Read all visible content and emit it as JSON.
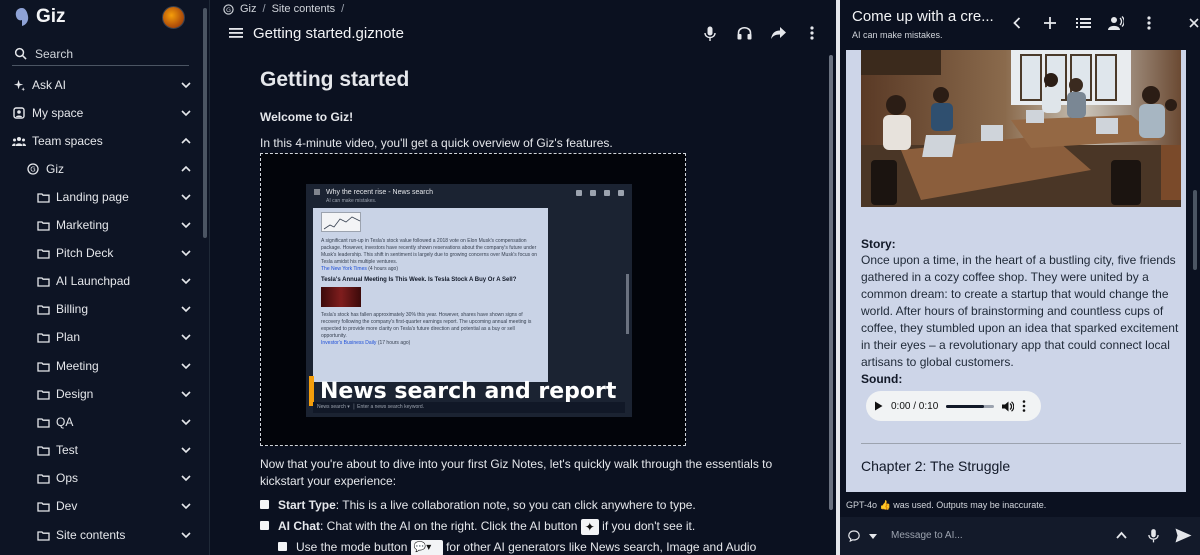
{
  "sidebar": {
    "brand": "Giz",
    "search_label": "Search",
    "items": [
      {
        "label": "Ask AI",
        "icon": "sparkle-icon"
      },
      {
        "label": "My space",
        "icon": "person-square-icon"
      },
      {
        "label": "Team spaces",
        "icon": "team-icon"
      },
      {
        "label": "Giz",
        "icon": "giz-icon"
      },
      {
        "label": "Landing page",
        "icon": "folder-icon"
      },
      {
        "label": "Marketing",
        "icon": "folder-icon"
      },
      {
        "label": "Pitch Deck",
        "icon": "folder-icon"
      },
      {
        "label": "AI Launchpad",
        "icon": "folder-icon"
      },
      {
        "label": "Billing",
        "icon": "folder-icon"
      },
      {
        "label": "Plan",
        "icon": "folder-icon"
      },
      {
        "label": "Meeting",
        "icon": "folder-icon"
      },
      {
        "label": "Design",
        "icon": "folder-icon"
      },
      {
        "label": "QA",
        "icon": "folder-icon"
      },
      {
        "label": "Test",
        "icon": "folder-icon"
      },
      {
        "label": "Ops",
        "icon": "folder-icon"
      },
      {
        "label": "Dev",
        "icon": "folder-icon"
      },
      {
        "label": "Site contents",
        "icon": "folder-icon"
      }
    ]
  },
  "main": {
    "breadcrumb": [
      "Giz",
      "Site contents"
    ],
    "breadcrumb_sep": "/",
    "doc_title": "Getting started.giznote",
    "heading": "Getting started",
    "welcome": "Welcome to Giz!",
    "intro": "In this 4-minute video, you'll get a quick overview of Giz's features.",
    "video": {
      "title": "Why the recent rise - News search",
      "subtitle": "AI can make mistakes.",
      "p1": "A significant run-up in Tesla's stock value followed a 2018 vote on Elon Musk's compensation package. However, investors have recently shown reservations about the company's future under Musk's leadership. This shift in sentiment is largely due to growing concerns over Musk's focus on Tesla amidst his multiple ventures.",
      "source1": "The New York Times",
      "source1_time": "(4 hours ago)",
      "headline": "Tesla's Annual Meeting Is This Week. Is Tesla Stock A Buy Or A Sell?",
      "p2": "Tesla's stock has fallen approximately 30% this year. However, shares have shown signs of recovery following the company's first-quarter earnings report. The upcoming annual meeting is expected to provide more clarity on Tesla's future direction and potential as a buy or sell opportunity.",
      "source2": "Investor's Business Daily",
      "source2_time": "(17 hours ago)",
      "caption": "News search and report",
      "mode": "News search",
      "input_placeholder": "Enter a news search keyword."
    },
    "para": "Now that you're about to dive into your first Giz Notes, let's quickly walk through the essentials to kickstart your experience:",
    "checks": [
      {
        "bold": "Start Type",
        "text": ": This is a live collaboration note, so you can click anywhere to type."
      },
      {
        "bold": "AI Chat",
        "text": ": Chat with the AI on the right. Click the AI button",
        "tail": "if you don't see it."
      },
      {
        "bold": "",
        "text": "Use the mode button",
        "tail": "for other AI generators like News search, Image and Audio"
      }
    ]
  },
  "chat": {
    "title": "Come up with a cre...",
    "subtitle": "AI can make mistakes.",
    "story_label": "Story:",
    "story_text": "Once upon a time, in the heart of a bustling city, five friends gathered in a cozy coffee shop. They were united by a common dream: to create a startup that would change the world. After hours of brainstorming and countless cups of coffee, they stumbled upon an idea that sparked excitement in their eyes – a revolutionary app that could connect local artisans to global customers.",
    "sound_label": "Sound:",
    "audio_time": "0:00 / 0:10",
    "chapter": "Chapter 2: The Struggle",
    "model_note": "GPT-4o 👍 was used. Outputs may be inaccurate.",
    "input_placeholder": "Message to AI..."
  }
}
